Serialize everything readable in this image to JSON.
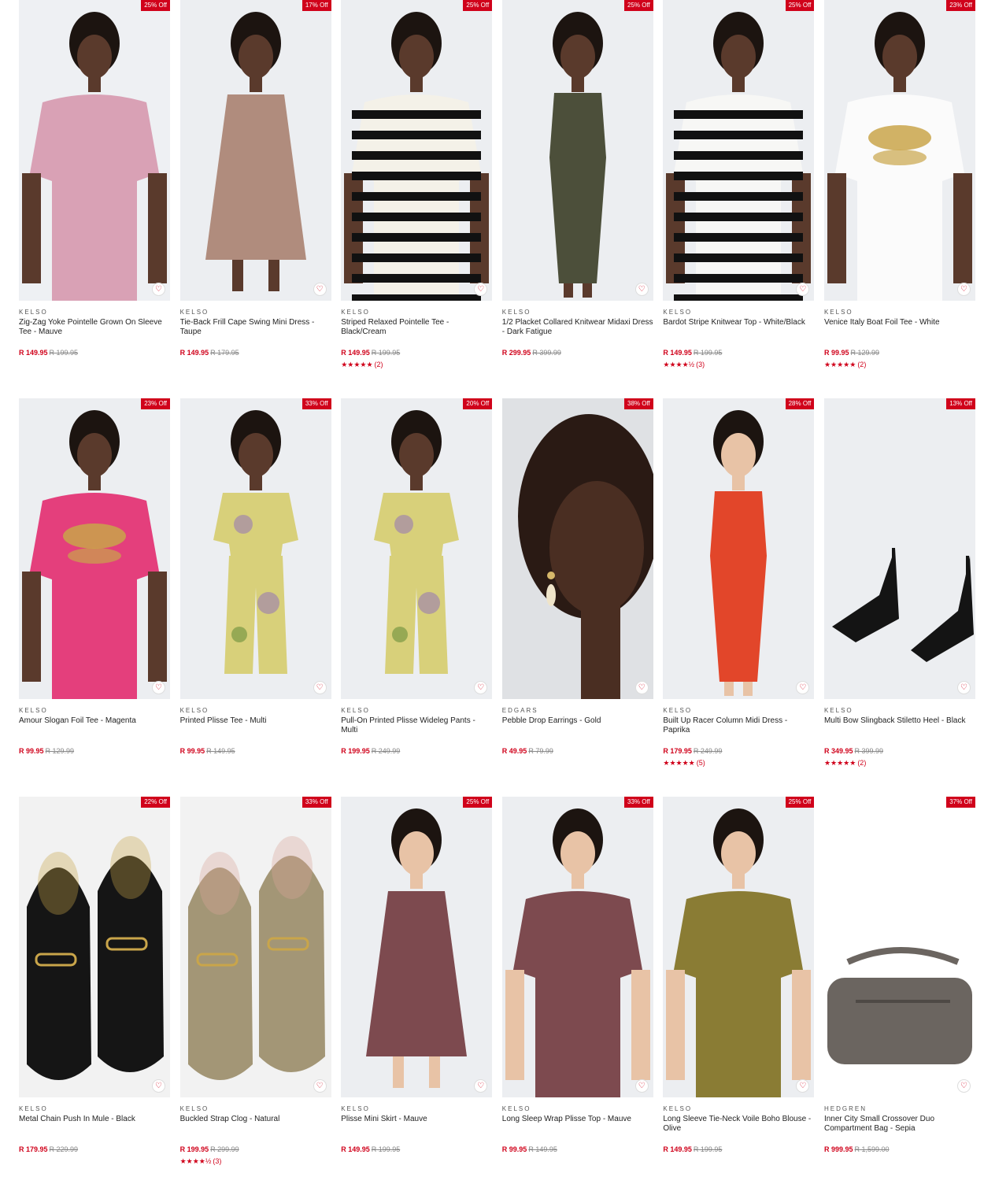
{
  "products": [
    {
      "brand": "KELSO",
      "name": "Zig-Zag Yoke Pointelle Grown On Sleeve Tee - Mauve",
      "price": "R 149.95",
      "was": "R 199.95",
      "badge": "25% Off",
      "stars": "",
      "reviews": "",
      "img": {
        "bg": "#eef0f3",
        "main": "#d9a1b5",
        "skin": "#5a3a2c",
        "kind": "top"
      }
    },
    {
      "brand": "KELSO",
      "name": "Tie-Back Frill Cape Swing Mini Dress - Taupe",
      "price": "R 149.95",
      "was": "R 179.95",
      "badge": "17% Off",
      "stars": "",
      "reviews": "",
      "img": {
        "bg": "#eceef1",
        "main": "#b08c7d",
        "skin": "#5a3a2c",
        "kind": "dress"
      }
    },
    {
      "brand": "KELSO",
      "name": "Striped Relaxed Pointelle Tee - Black/Cream",
      "price": "R 149.95",
      "was": "R 199.95",
      "badge": "25% Off",
      "stars": "★★★★★",
      "reviews": "(2)",
      "img": {
        "bg": "#eceef1",
        "main": "#f4f1e8",
        "stripe": "#111111",
        "skin": "#5a3a2c",
        "kind": "stripe"
      }
    },
    {
      "brand": "KELSO",
      "name": "1/2 Placket Collared Knitwear Midaxi Dress - Dark Fatigue",
      "price": "R 299.95",
      "was": "R 399.99",
      "badge": "25% Off",
      "stars": "",
      "reviews": "",
      "img": {
        "bg": "#eceef1",
        "main": "#4c4f3a",
        "skin": "#5a3a2c",
        "kind": "long"
      }
    },
    {
      "brand": "KELSO",
      "name": "Bardot Stripe Knitwear Top - White/Black",
      "price": "R 149.95",
      "was": "R 199.95",
      "badge": "25% Off",
      "stars": "★★★★½",
      "reviews": "(3)",
      "img": {
        "bg": "#eceef1",
        "main": "#f7f7f5",
        "stripe": "#111111",
        "skin": "#5a3a2c",
        "kind": "stripe"
      }
    },
    {
      "brand": "KELSO",
      "name": "Venice Italy Boat Foil Tee - White",
      "price": "R 99.95",
      "was": "R 129.99",
      "badge": "23% Off",
      "stars": "★★★★★",
      "reviews": "(2)",
      "img": {
        "bg": "#eceef1",
        "main": "#fbfbfb",
        "accent": "#c9a54a",
        "skin": "#5a3a2c",
        "kind": "print"
      }
    },
    {
      "brand": "KELSO",
      "name": "Amour Slogan Foil Tee - Magenta",
      "price": "R 99.95",
      "was": "R 129.99",
      "badge": "23% Off",
      "stars": "",
      "reviews": "",
      "img": {
        "bg": "#eceef1",
        "main": "#e43f7c",
        "accent": "#c9a54a",
        "skin": "#5a3a2c",
        "kind": "print"
      }
    },
    {
      "brand": "KELSO",
      "name": "Printed Plisse Tee - Multi",
      "price": "R 99.95",
      "was": "R 149.95",
      "badge": "33% Off",
      "stars": "",
      "reviews": "",
      "img": {
        "bg": "#eceef1",
        "main": "#d8d07a",
        "accent": "#9a7bb3",
        "skin": "#5a3a2c",
        "kind": "set"
      }
    },
    {
      "brand": "KELSO",
      "name": "Pull-On Printed Plisse Wideleg Pants - Multi",
      "price": "R 199.95",
      "was": "R 249.99",
      "badge": "20% Off",
      "stars": "",
      "reviews": "",
      "img": {
        "bg": "#eceef1",
        "main": "#d8d07a",
        "accent": "#9a7bb3",
        "skin": "#5a3a2c",
        "kind": "set"
      }
    },
    {
      "brand": "EDGARS",
      "name": "Pebble Drop Earrings - Gold",
      "price": "R 49.95",
      "was": "R 79.99",
      "badge": "38% Off",
      "stars": "",
      "reviews": "",
      "img": {
        "bg": "#dfe1e4",
        "main": "#2a1a14",
        "skin": "#4a2e22",
        "kind": "face"
      }
    },
    {
      "brand": "KELSO",
      "name": "Built Up Racer Column Midi Dress - Paprika",
      "price": "R 179.95",
      "was": "R 249.99",
      "badge": "28% Off",
      "stars": "★★★★★",
      "reviews": "(5)",
      "img": {
        "bg": "#eceef1",
        "main": "#e2462a",
        "skin": "#e8c3a6",
        "kind": "long"
      }
    },
    {
      "brand": "KELSO",
      "name": "Multi Bow Slingback Stiletto Heel - Black",
      "price": "R 349.95",
      "was": "R 399.99",
      "badge": "13% Off",
      "stars": "★★★★★",
      "reviews": "(2)",
      "img": {
        "bg": "#eceef1",
        "main": "#141414",
        "kind": "heels"
      }
    },
    {
      "brand": "KELSO",
      "name": "Metal Chain Push In Mule - Black",
      "price": "R 179.95",
      "was": "R 229.99",
      "badge": "22% Off",
      "stars": "",
      "reviews": "",
      "img": {
        "bg": "#f2f2f2",
        "main": "#151515",
        "accent": "#c9a54a",
        "kind": "mules"
      }
    },
    {
      "brand": "KELSO",
      "name": "Buckled Strap Clog - Natural",
      "price": "R 199.95",
      "was": "R 299.99",
      "badge": "33% Off",
      "stars": "★★★★½",
      "reviews": "(3)",
      "img": {
        "bg": "#f2f2f2",
        "main": "#a39676",
        "accent": "#d9a79c",
        "kind": "mules"
      }
    },
    {
      "brand": "KELSO",
      "name": "Plisse Mini Skirt - Mauve",
      "price": "R 149.95",
      "was": "R 199.95",
      "badge": "25% Off",
      "stars": "",
      "reviews": "",
      "img": {
        "bg": "#eceef1",
        "main": "#7d4a4f",
        "skin": "#e8c3a6",
        "kind": "dress"
      }
    },
    {
      "brand": "KELSO",
      "name": "Long Sleep Wrap Plisse Top - Mauve",
      "price": "R 99.95",
      "was": "R 149.95",
      "badge": "33% Off",
      "stars": "",
      "reviews": "",
      "img": {
        "bg": "#eceef1",
        "main": "#7d4a4f",
        "skin": "#e8c3a6",
        "kind": "top"
      }
    },
    {
      "brand": "KELSO",
      "name": "Long Sleeve Tie-Neck Voile Boho Blouse - Olive",
      "price": "R 149.95",
      "was": "R 199.95",
      "badge": "25% Off",
      "stars": "",
      "reviews": "",
      "img": {
        "bg": "#eceef1",
        "main": "#8a7c34",
        "skin": "#e8c3a6",
        "kind": "top"
      }
    },
    {
      "brand": "HEDGREN",
      "name": "Inner City Small Crossover Duo Compartment Bag - Sepia",
      "price": "R 999.95",
      "was": "R 1,599.00",
      "badge": "37% Off",
      "stars": "",
      "reviews": "",
      "img": {
        "bg": "#ffffff",
        "main": "#6b6560",
        "kind": "bag"
      }
    }
  ],
  "ui": {
    "wishlist_glyph": "♡"
  }
}
